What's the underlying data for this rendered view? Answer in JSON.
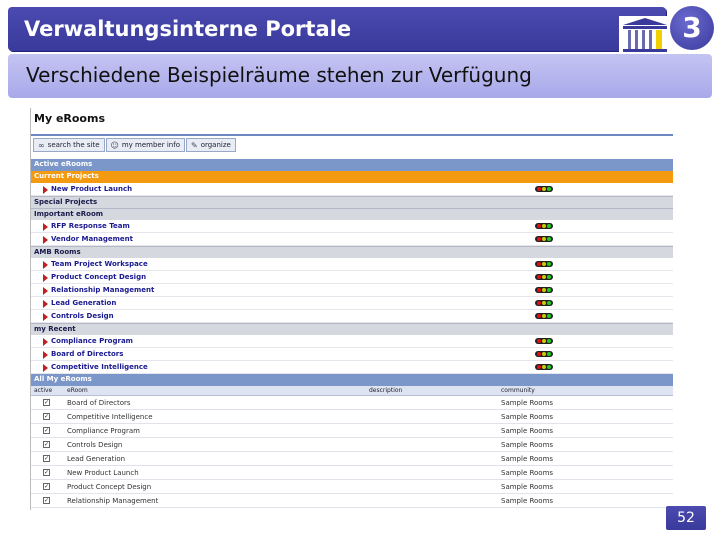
{
  "slide": {
    "title": "Verwaltungsinterne Portale",
    "chapter": "3",
    "subtitle": "Verschiedene Beispielräume stehen zur Verfügung",
    "page_number": "52",
    "colors": {
      "title_bar": "#3a3a9c",
      "subtitle_bar": "#a8a8ea"
    },
    "logo_icon": "building-columns-icon"
  },
  "erooms": {
    "title": "My eRooms",
    "toolbar": [
      {
        "label": "search the site",
        "icon": "binoculars-icon"
      },
      {
        "label": "my member info",
        "icon": "member-icon"
      },
      {
        "label": "organize",
        "icon": "pencil-icon"
      }
    ],
    "active_header": "Active eRooms",
    "groups": [
      {
        "label": "Current Projects",
        "style": "orange",
        "items": [
          "New Product Launch"
        ]
      },
      {
        "label": "Special Projects",
        "style": "grey",
        "items": []
      },
      {
        "label": "Important eRoom",
        "style": "grey",
        "items": [
          "RFP Response Team",
          "Vendor Management"
        ]
      },
      {
        "label": "AMB Rooms",
        "style": "grey",
        "items": [
          "Team Project Workspace",
          "Product Concept Design",
          "Relationship Management",
          "Lead Generation",
          "Controls Design"
        ]
      },
      {
        "label": "my Recent",
        "style": "grey",
        "items": [
          "Compliance Program",
          "Board of Directors",
          "Competitive Intelligence"
        ]
      }
    ],
    "all_header": "All My eRooms",
    "columns": {
      "active": "active",
      "eroom": "eRoom",
      "description": "description",
      "community": "community"
    },
    "table_rows": [
      {
        "eroom": "Board of Directors",
        "community": "Sample Rooms"
      },
      {
        "eroom": "Competitive Intelligence",
        "community": "Sample Rooms"
      },
      {
        "eroom": "Compliance Program",
        "community": "Sample Rooms"
      },
      {
        "eroom": "Controls Design",
        "community": "Sample Rooms"
      },
      {
        "eroom": "Lead Generation",
        "community": "Sample Rooms"
      },
      {
        "eroom": "New Product Launch",
        "community": "Sample Rooms"
      },
      {
        "eroom": "Product Concept Design",
        "community": "Sample Rooms"
      },
      {
        "eroom": "Relationship Management",
        "community": "Sample Rooms"
      }
    ]
  }
}
